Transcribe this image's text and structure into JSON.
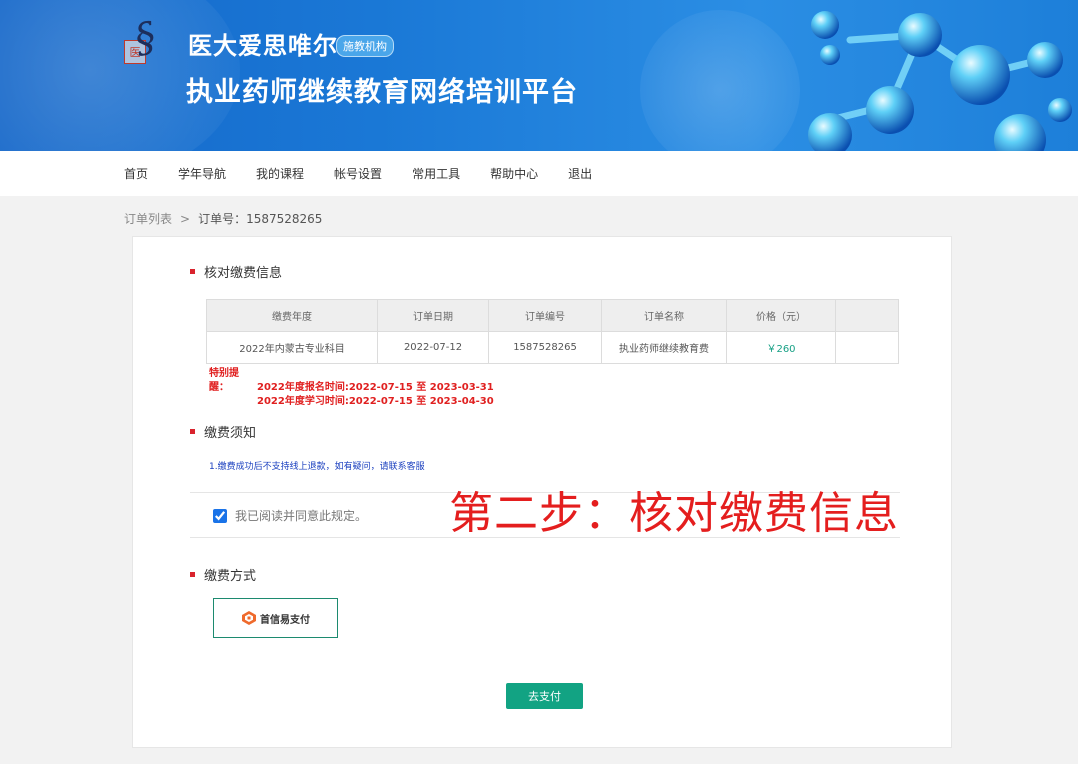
{
  "header": {
    "brand_seal": "医",
    "brand_name": "医大爱思唯尔",
    "brand_badge": "施教机构",
    "platform_title": "执业药师继续教育网络培训平台"
  },
  "nav": {
    "items": [
      "首页",
      "学年导航",
      "我的课程",
      "帐号设置",
      "常用工具",
      "帮助中心",
      "退出"
    ]
  },
  "breadcrumb": {
    "parent": "订单列表",
    "separator": ">",
    "current": "订单号：1587528265"
  },
  "section_verify": {
    "title": "核对缴费信息",
    "table": {
      "headers": [
        "缴费年度",
        "订单日期",
        "订单编号",
        "订单名称",
        "价格（元）",
        ""
      ],
      "rows": [
        [
          "2022年内蒙古专业科目",
          "2022-07-12",
          "1587528265",
          "执业药师继续教育费",
          "￥260",
          ""
        ]
      ]
    },
    "reminder_label": "特别提醒：",
    "reminder_line1": "2022年度报名时间:2022-07-15 至 2023-03-31",
    "reminder_line2": "2022年度学习时间:2022-07-15 至 2023-04-30"
  },
  "section_notice": {
    "title": "缴费须知",
    "text": "1.缴费成功后不支持线上退款，如有疑问，请联系客服",
    "agree_label": "我已阅读并同意此规定。",
    "agree_checked": true
  },
  "overlay": {
    "text": "第二步：核对缴费信息"
  },
  "section_payment": {
    "title": "缴费方式",
    "option_label": "首信易支付",
    "submit_label": "去支付"
  },
  "colors": {
    "banner": "#1a78d6",
    "accent_green": "#12a383",
    "bullet_red": "#d9232d",
    "overlay_red": "#e41e1e"
  }
}
